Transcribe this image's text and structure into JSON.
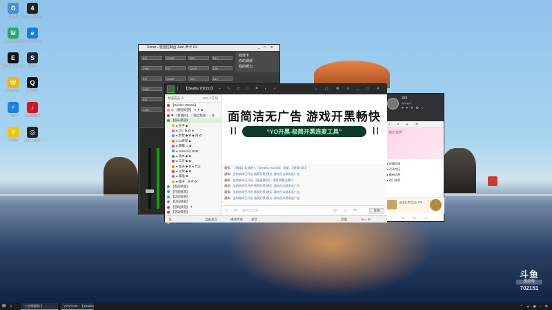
{
  "desktop": {
    "icons": [
      {
        "label": "回收站",
        "x": 0,
        "y": 0,
        "color": "#4a90d9",
        "glyph": "♻",
        "icon": "recycle-bin-icon"
      },
      {
        "label": "Left 4 Dead 2",
        "x": 0,
        "y": 0,
        "color": "#222",
        "glyph": "4",
        "icon": "game-icon"
      },
      {
        "label": "MuMu模拟器",
        "x": 0,
        "y": 0,
        "color": "#2a6",
        "glyph": "M",
        "icon": "app-icon"
      },
      {
        "label": "Microsoft Edge",
        "x": 0,
        "y": 0,
        "color": "#1a7fd3",
        "glyph": "e",
        "icon": "edge-icon"
      },
      {
        "label": "Epic Games Launcher",
        "x": 0,
        "y": 0,
        "color": "#111",
        "glyph": "E",
        "icon": "epic-icon"
      },
      {
        "label": "Steam",
        "x": 0,
        "y": 0,
        "color": "#1b2838",
        "glyph": "S",
        "icon": "steam-icon"
      },
      {
        "label": "WeGame",
        "x": 0,
        "y": 0,
        "color": "#f0b600",
        "glyph": "W",
        "icon": "wegame-icon"
      },
      {
        "label": "腾讯QQ",
        "x": 0,
        "y": 0,
        "color": "#111",
        "glyph": "Q",
        "icon": "qq-icon"
      },
      {
        "label": "迅雷",
        "x": 0,
        "y": 0,
        "color": "#1e7fe0",
        "glyph": "⚡",
        "icon": "thunder-icon"
      },
      {
        "label": "网易云音乐",
        "x": 0,
        "y": 0,
        "color": "#d12",
        "glyph": "♪",
        "icon": "music-icon"
      },
      {
        "label": "YY语音",
        "x": 0,
        "y": 0,
        "color": "#f5c400",
        "glyph": "Y",
        "icon": "yy-icon"
      },
      {
        "label": "OBS Studio",
        "x": 0,
        "y": 0,
        "color": "#222",
        "glyph": "◎",
        "icon": "obs-icon"
      }
    ]
  },
  "mixer": {
    "title": "Sonar - 混音控制台 Asio 声卡 FX",
    "menu": [
      "有效卡",
      "你的调频",
      "我的努力"
    ],
    "fx_labels": [
      "EQ",
      "COMP",
      "REV",
      "DLY",
      "CHO",
      "PIT",
      "GATE",
      "LIM"
    ]
  },
  "yy": {
    "room_id": "Ⅰ",
    "room_name": "【Deaths 702151】",
    "top_tools": "⌁ ✎ ⇄ ♫ ⚑ ◐ ◑",
    "top_ctrls": "⌂ ▢ ⚙ ≡ _ □ ✕",
    "left_head": "频道成员  人",
    "left_head_right": "205 人在线",
    "tree": [
      {
        "text": "【Deaths 702151】",
        "color": "#e33"
      },
      {
        "text": "③ 【频道欢迎】 ⚘ ⚘ ✿",
        "color": "#f90"
      },
      {
        "text": "❤ 【直播间】 ♫ 独立频道 ♀♂ ✿",
        "color": "#e33"
      },
      {
        "text": "【娱乐频道】",
        "color": "#3a3",
        "sel": true
      },
      {
        "text": "● 豆子 ◆",
        "color": "#fa3"
      },
      {
        "text": "● 小C ✿ ✿ ★",
        "color": "#e5a"
      },
      {
        "text": "● 梦想 ◆ ✿ ◆ 雨 ✿ ",
        "color": "#39f"
      },
      {
        "text": "● ox哥哥 ◆",
        "color": "#f60"
      },
      {
        "text": "● 糖糖 ☆ ✿",
        "color": "#c3c"
      },
      {
        "text": "● Draw 8号 ✿ ✿",
        "color": "#39c"
      },
      {
        "text": "● 清水 ◆ ✿",
        "color": "#3a3"
      },
      {
        "text": "● 三声 ◆ ✿",
        "color": "#d44"
      },
      {
        "text": "● 星光 ◆ ✿ ● 代言",
        "color": "#f80"
      },
      {
        "text": "● 火柴 ◆ ✿",
        "color": "#e33"
      },
      {
        "text": "● 喵喵 ✿",
        "color": "#a5f"
      },
      {
        "text": "● 橘子 · 豆子 ✿",
        "color": "#fa0"
      },
      {
        "text": "【电竞频道】",
        "color": "#39f"
      },
      {
        "text": "【开黑频道】",
        "color": "#39f"
      },
      {
        "text": "【队伍频道】",
        "color": "#39f"
      },
      {
        "text": "【队伍频道】",
        "color": "#39f"
      },
      {
        "text": "【活动频道】 ⚘",
        "color": "#e33"
      },
      {
        "text": "【活动频道】",
        "color": "#e33"
      },
      {
        "text": "③ 【主播频道】 ♀ ♀ ♀",
        "color": "#f90"
      },
      {
        "text": "③ 【主播频道】 ♀ ♀ ♀",
        "color": "#f90"
      }
    ],
    "banner_line1": "面简洁无广告 游戏开黑畅快",
    "banner_line2": "“YO开黑-极简开黑连麦工具”",
    "chat": [
      {
        "tag": "通知:",
        "text": "【频道】欢迎进入 【Deaths 702151】 频道, 【频道公告】"
      },
      {
        "tag": "通知:",
        "text": "当前房间已开启 极简开黑 模式,  请勿在公屏发送广告"
      },
      {
        "tag": "通知:",
        "text": "当前房间已开启 【连麦模式】, 语音质量已提升"
      },
      {
        "tag": "通知:",
        "text": "当前房间已开启 极简开黑 模式,  请勿在公屏发送广告"
      },
      {
        "tag": "通知:",
        "text": "当前房间已开启 极简开黑 模式,  请勿在公屏发送广告"
      },
      {
        "tag": "通知:",
        "text": "当前房间已开启 极简开黑 模式,  请勿在公屏发送广告"
      }
    ],
    "input_tools": "☺ ✂",
    "input_placeholder": "聊点什么吧...",
    "input_tools2": "⊙ ♫ ✎",
    "send_label": "发送",
    "bottom": {
      "mic": "自由发言",
      "music": "播放伴奏",
      "record": "录音",
      "settings": "设置",
      "right1": "音量",
      "right2": "✉ ◐ ⚙"
    }
  },
  "profile": {
    "name": "222",
    "sub": "yy1 yy1",
    "badges": "♥ ♥ ★ ✿ ☆",
    "tabs": "☺ ♥ ★ ⚑",
    "promo_title": "娱乐世界",
    "list": [
      "● 直播频道",
      "● 活动专区",
      "● 最新消息",
      "● 热门推荐"
    ],
    "gift_text": "送出礼物 连击 x99",
    "footer": "⌂ ♥ ✉ ≡"
  },
  "watermark": {
    "logo": "斗鱼",
    "label": "房间号",
    "number": "702151"
  },
  "taskbar": {
    "start": "⊞",
    "search": "⌕",
    "task1": "【 出场游戏 】 ...",
    "task2": "YY/YOYO - 【 Deaths 702151 】 - ...",
    "tray": "⌃ ☁ ▣ ♪ 中"
  }
}
